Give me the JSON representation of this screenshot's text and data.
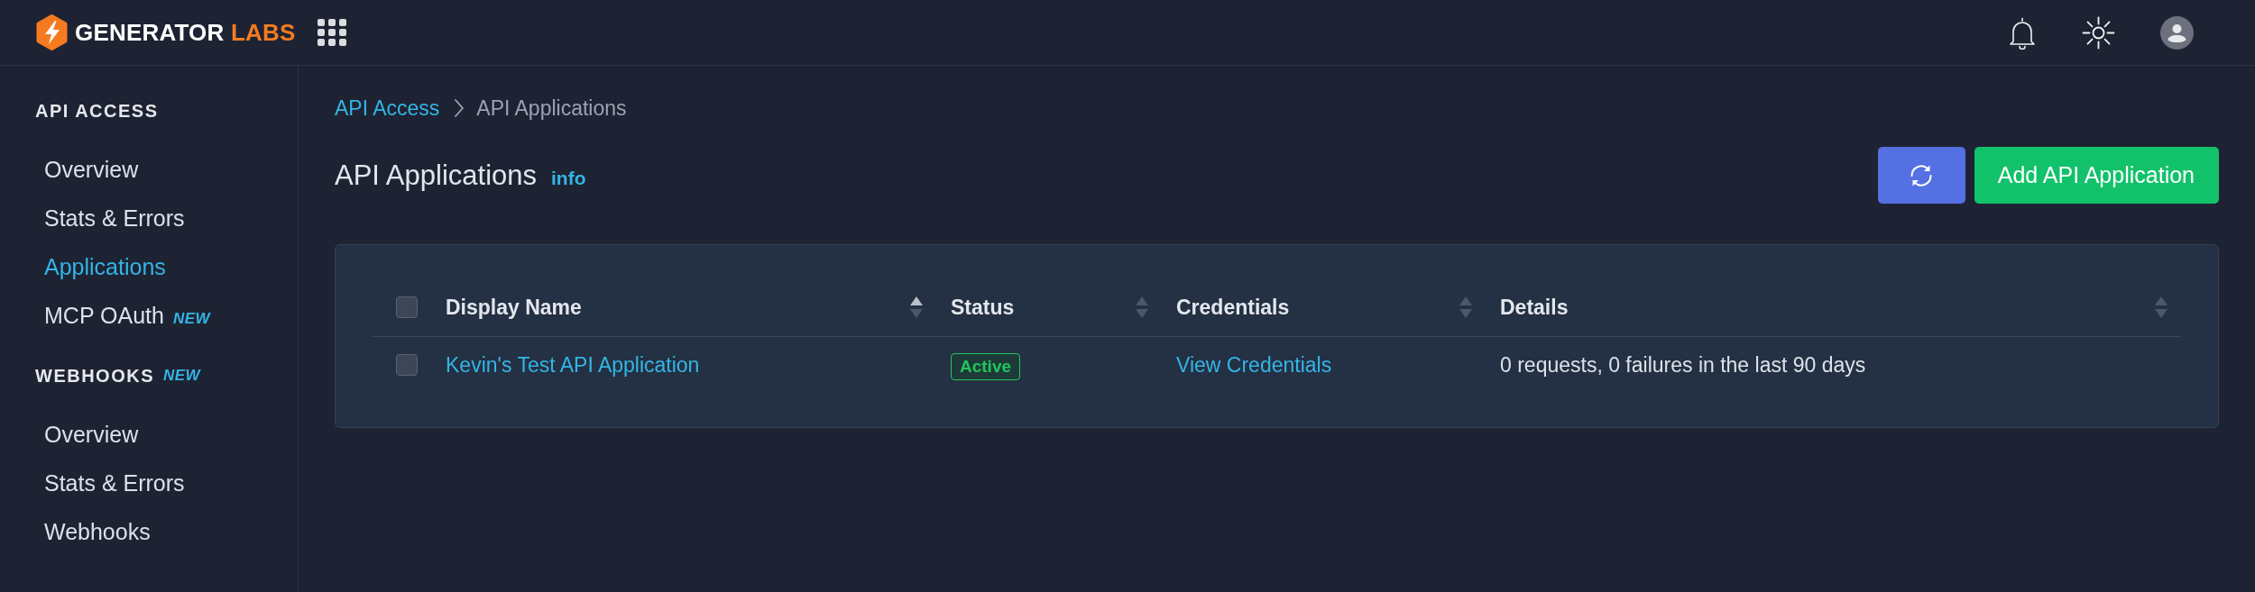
{
  "brand": {
    "name": "GENERATOR",
    "accent": "LABS"
  },
  "sidebar": {
    "sections": [
      {
        "title": "API ACCESS",
        "items": [
          {
            "label": "Overview",
            "selected": false
          },
          {
            "label": "Stats & Errors",
            "selected": false
          },
          {
            "label": "Applications",
            "selected": true
          },
          {
            "label": "MCP OAuth",
            "selected": false,
            "badge": "NEW"
          }
        ]
      },
      {
        "title": "WEBHOOKS",
        "badge": "NEW",
        "items": [
          {
            "label": "Overview",
            "selected": false
          },
          {
            "label": "Stats & Errors",
            "selected": false
          },
          {
            "label": "Webhooks",
            "selected": false
          }
        ]
      }
    ]
  },
  "breadcrumb": [
    {
      "label": "API Access",
      "kind": "link"
    },
    {
      "label": "API Applications",
      "kind": "current"
    }
  ],
  "page": {
    "title": "API Applications",
    "info_link": "info"
  },
  "actions": [
    {
      "kind": "refresh"
    },
    {
      "kind": "add",
      "label": "Add API Application"
    }
  ],
  "table": {
    "select_all": {
      "checked": false
    },
    "columns": [
      {
        "label": "Display Name",
        "sorted": true
      },
      {
        "label": "Status",
        "sorted": false
      },
      {
        "label": "Credentials",
        "sorted": false
      },
      {
        "label": "Details",
        "sorted": false
      }
    ],
    "rows": [
      {
        "checked": false,
        "display_name": "Kevin's Test API Application",
        "status": "Active",
        "credentials": "View Credentials",
        "details": "0 requests, 0 failures in the last 90 days"
      }
    ]
  }
}
